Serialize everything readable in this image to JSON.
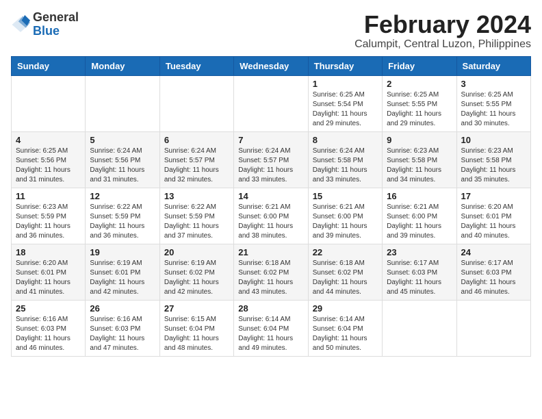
{
  "logo": {
    "general": "General",
    "blue": "Blue"
  },
  "header": {
    "month_year": "February 2024",
    "location": "Calumpit, Central Luzon, Philippines"
  },
  "weekdays": [
    "Sunday",
    "Monday",
    "Tuesday",
    "Wednesday",
    "Thursday",
    "Friday",
    "Saturday"
  ],
  "weeks": [
    [
      {
        "day": "",
        "content": ""
      },
      {
        "day": "",
        "content": ""
      },
      {
        "day": "",
        "content": ""
      },
      {
        "day": "",
        "content": ""
      },
      {
        "day": "1",
        "content": "Sunrise: 6:25 AM\nSunset: 5:54 PM\nDaylight: 11 hours and 29 minutes."
      },
      {
        "day": "2",
        "content": "Sunrise: 6:25 AM\nSunset: 5:55 PM\nDaylight: 11 hours and 29 minutes."
      },
      {
        "day": "3",
        "content": "Sunrise: 6:25 AM\nSunset: 5:55 PM\nDaylight: 11 hours and 30 minutes."
      }
    ],
    [
      {
        "day": "4",
        "content": "Sunrise: 6:25 AM\nSunset: 5:56 PM\nDaylight: 11 hours and 31 minutes."
      },
      {
        "day": "5",
        "content": "Sunrise: 6:24 AM\nSunset: 5:56 PM\nDaylight: 11 hours and 31 minutes."
      },
      {
        "day": "6",
        "content": "Sunrise: 6:24 AM\nSunset: 5:57 PM\nDaylight: 11 hours and 32 minutes."
      },
      {
        "day": "7",
        "content": "Sunrise: 6:24 AM\nSunset: 5:57 PM\nDaylight: 11 hours and 33 minutes."
      },
      {
        "day": "8",
        "content": "Sunrise: 6:24 AM\nSunset: 5:58 PM\nDaylight: 11 hours and 33 minutes."
      },
      {
        "day": "9",
        "content": "Sunrise: 6:23 AM\nSunset: 5:58 PM\nDaylight: 11 hours and 34 minutes."
      },
      {
        "day": "10",
        "content": "Sunrise: 6:23 AM\nSunset: 5:58 PM\nDaylight: 11 hours and 35 minutes."
      }
    ],
    [
      {
        "day": "11",
        "content": "Sunrise: 6:23 AM\nSunset: 5:59 PM\nDaylight: 11 hours and 36 minutes."
      },
      {
        "day": "12",
        "content": "Sunrise: 6:22 AM\nSunset: 5:59 PM\nDaylight: 11 hours and 36 minutes."
      },
      {
        "day": "13",
        "content": "Sunrise: 6:22 AM\nSunset: 5:59 PM\nDaylight: 11 hours and 37 minutes."
      },
      {
        "day": "14",
        "content": "Sunrise: 6:21 AM\nSunset: 6:00 PM\nDaylight: 11 hours and 38 minutes."
      },
      {
        "day": "15",
        "content": "Sunrise: 6:21 AM\nSunset: 6:00 PM\nDaylight: 11 hours and 39 minutes."
      },
      {
        "day": "16",
        "content": "Sunrise: 6:21 AM\nSunset: 6:00 PM\nDaylight: 11 hours and 39 minutes."
      },
      {
        "day": "17",
        "content": "Sunrise: 6:20 AM\nSunset: 6:01 PM\nDaylight: 11 hours and 40 minutes."
      }
    ],
    [
      {
        "day": "18",
        "content": "Sunrise: 6:20 AM\nSunset: 6:01 PM\nDaylight: 11 hours and 41 minutes."
      },
      {
        "day": "19",
        "content": "Sunrise: 6:19 AM\nSunset: 6:01 PM\nDaylight: 11 hours and 42 minutes."
      },
      {
        "day": "20",
        "content": "Sunrise: 6:19 AM\nSunset: 6:02 PM\nDaylight: 11 hours and 42 minutes."
      },
      {
        "day": "21",
        "content": "Sunrise: 6:18 AM\nSunset: 6:02 PM\nDaylight: 11 hours and 43 minutes."
      },
      {
        "day": "22",
        "content": "Sunrise: 6:18 AM\nSunset: 6:02 PM\nDaylight: 11 hours and 44 minutes."
      },
      {
        "day": "23",
        "content": "Sunrise: 6:17 AM\nSunset: 6:03 PM\nDaylight: 11 hours and 45 minutes."
      },
      {
        "day": "24",
        "content": "Sunrise: 6:17 AM\nSunset: 6:03 PM\nDaylight: 11 hours and 46 minutes."
      }
    ],
    [
      {
        "day": "25",
        "content": "Sunrise: 6:16 AM\nSunset: 6:03 PM\nDaylight: 11 hours and 46 minutes."
      },
      {
        "day": "26",
        "content": "Sunrise: 6:16 AM\nSunset: 6:03 PM\nDaylight: 11 hours and 47 minutes."
      },
      {
        "day": "27",
        "content": "Sunrise: 6:15 AM\nSunset: 6:04 PM\nDaylight: 11 hours and 48 minutes."
      },
      {
        "day": "28",
        "content": "Sunrise: 6:14 AM\nSunset: 6:04 PM\nDaylight: 11 hours and 49 minutes."
      },
      {
        "day": "29",
        "content": "Sunrise: 6:14 AM\nSunset: 6:04 PM\nDaylight: 11 hours and 50 minutes."
      },
      {
        "day": "",
        "content": ""
      },
      {
        "day": "",
        "content": ""
      }
    ]
  ]
}
